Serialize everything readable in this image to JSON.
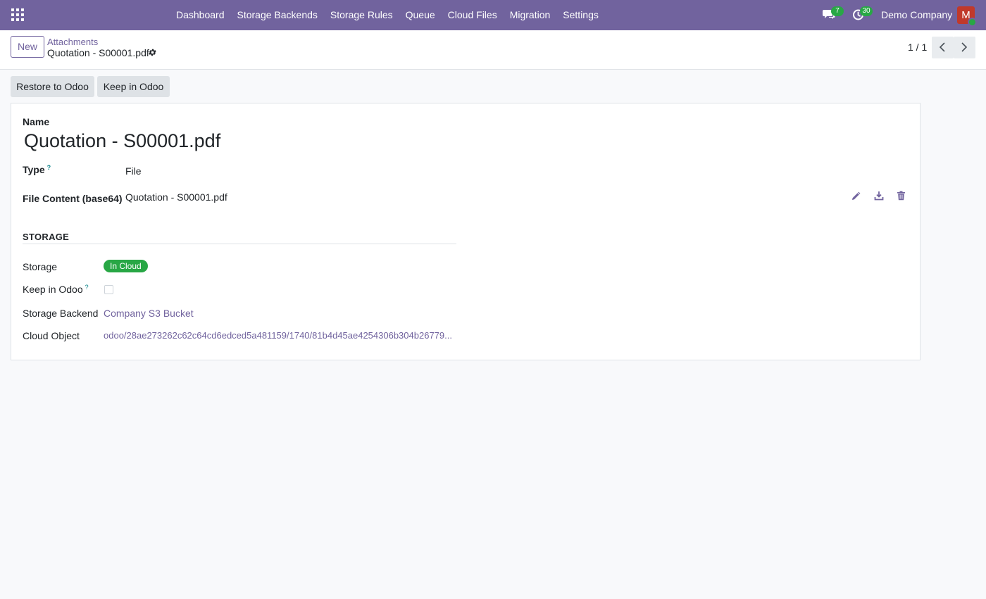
{
  "navbar": {
    "menu": [
      "Dashboard",
      "Storage Backends",
      "Storage Rules",
      "Queue",
      "Cloud Files",
      "Migration",
      "Settings"
    ],
    "messages_count": "7",
    "activities_count": "30",
    "company": "Demo Company",
    "avatar_initial": "M",
    "icons": [
      "apps-grid-icon",
      "chat-icon",
      "clock-icon"
    ],
    "accent_color": "#71639e"
  },
  "control_panel": {
    "new_label": "New",
    "breadcrumb_parent": "Attachments",
    "breadcrumb_current": "Quotation - S00001.pdf",
    "pager": "1 / 1"
  },
  "actions": {
    "restore_label": "Restore to Odoo",
    "keep_label": "Keep in Odoo"
  },
  "form": {
    "name_label": "Name",
    "name_value": "Quotation - S00001.pdf",
    "type_label": "Type",
    "type_value": "File",
    "file_label": "File Content (base64)",
    "file_value": "Quotation - S00001.pdf",
    "storage_section": "STORAGE",
    "storage_label": "Storage",
    "storage_value": "In Cloud",
    "storage_color": "#28a745",
    "keep_label": "Keep in Odoo",
    "keep_checked": false,
    "backend_label": "Storage Backend",
    "backend_value": "Company S3 Bucket",
    "object_label": "Cloud Object",
    "object_value": "odoo/28ae273262c62c64cd6edced5a481159/1740/81b4d45ae4254306b304b26779..."
  }
}
